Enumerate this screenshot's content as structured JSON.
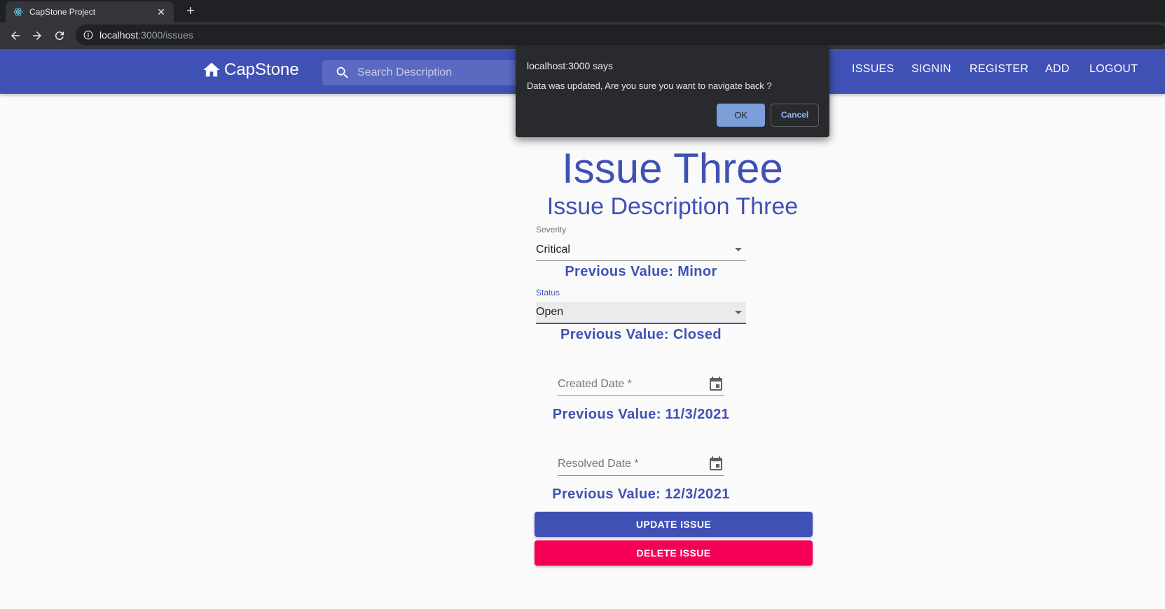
{
  "browser": {
    "tab_title": "CapStone Project",
    "url_host": "localhost",
    "url_path": ":3000/issues",
    "icons": [
      "react-favicon-icon",
      "close-icon",
      "plus-icon",
      "back-arrow-icon",
      "forward-arrow-icon",
      "reload-icon",
      "info-icon"
    ]
  },
  "appbar": {
    "brand": "CapStone",
    "search_placeholder": "Search Description",
    "nav": [
      "ISSUES",
      "SIGNIN",
      "REGISTER",
      "ADD",
      "LOGOUT"
    ],
    "color": "#3f51b5"
  },
  "issue": {
    "title": "Issue Three",
    "description": "Issue Description Three",
    "severity_label": "Severity",
    "severity_value": "Critical",
    "severity_prev": "Previous Value: Minor",
    "status_label": "Status",
    "status_value": "Open",
    "status_prev": "Previous Value: Closed",
    "created_label": "Created Date *",
    "created_prev": "Previous Value: 11/3/2021",
    "resolved_label": "Resolved Date *",
    "resolved_prev": "Previous Value: 12/3/2021"
  },
  "actions": {
    "update": "UPDATE ISSUE",
    "delete": "DELETE ISSUE",
    "update_color": "#3f51b5",
    "delete_color": "#f50057"
  },
  "dialog": {
    "title": "localhost:3000 says",
    "message": "Data was updated, Are you sure you want to navigate back ?",
    "ok": "OK",
    "cancel": "Cancel"
  }
}
